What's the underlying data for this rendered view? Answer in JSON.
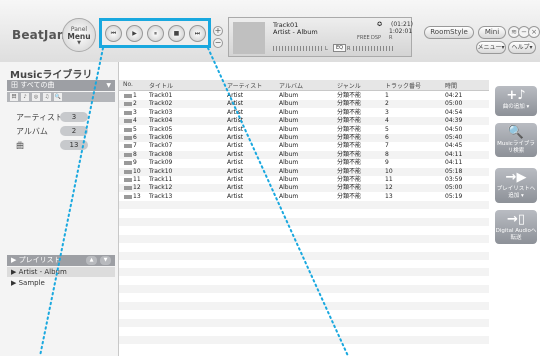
{
  "header": {
    "logo": "BeatJam",
    "panel_menu": {
      "line1": "Panel",
      "line2": "Menu",
      "chevron": "▼"
    },
    "transport": {
      "buttons": [
        {
          "name": "previous",
          "glyph": "⏮"
        },
        {
          "name": "play",
          "glyph": "▶"
        },
        {
          "name": "pause",
          "glyph": "⏸"
        },
        {
          "name": "stop",
          "glyph": "■"
        },
        {
          "name": "next",
          "glyph": "⏭"
        }
      ]
    },
    "volume": {
      "plus": "+",
      "minus": "−"
    },
    "now_playing": {
      "track": "Track01",
      "artist_album": "Artist - Album",
      "record_glyph": "✪",
      "time_total": "(01:21)",
      "time_current": "1:02:01",
      "meter_left": "L",
      "meter_right": "R",
      "mode_button": "EQ",
      "rate_label": "FREE",
      "rate_label2": "DSP",
      "rate_label3": "R"
    },
    "roomstyle_label": "RoomStyle",
    "mini_label": "Mini",
    "menu_label": "メニュー▾",
    "help_label": "ヘルプ▾",
    "window_buttons": [
      "≋",
      "−",
      "×"
    ]
  },
  "sidebar": {
    "title": "Musicライブラリ",
    "all_songs": "田 すべての曲",
    "all_songs_arrow": "▼",
    "filter_icons": [
      "田",
      "♪",
      "◎",
      "♫",
      "🔍"
    ],
    "categories": [
      {
        "label": "アーティスト",
        "count": "3"
      },
      {
        "label": "アルバム",
        "count": "2"
      },
      {
        "label": "曲",
        "count": "13"
      }
    ],
    "playlist_header": "▶ プレイリスト",
    "playlist_arrows": [
      "▲",
      "▼"
    ],
    "playlists": [
      "▶ Artist - Album",
      "▶ Sample"
    ]
  },
  "table": {
    "columns": [
      "No.",
      "タイトル",
      "アーティスト",
      "アルバム",
      "ジャンル",
      "トラック番号",
      "時間"
    ],
    "rows": [
      [
        "1",
        "Track01",
        "Artist",
        "Album",
        "分類不能",
        "1",
        "04:21"
      ],
      [
        "2",
        "Track02",
        "Artist",
        "Album",
        "分類不能",
        "2",
        "05:00"
      ],
      [
        "3",
        "Track03",
        "Artist",
        "Album",
        "分類不能",
        "3",
        "04:54"
      ],
      [
        "4",
        "Track04",
        "Artist",
        "Album",
        "分類不能",
        "4",
        "04:39"
      ],
      [
        "5",
        "Track05",
        "Artist",
        "Album",
        "分類不能",
        "5",
        "04:50"
      ],
      [
        "6",
        "Track06",
        "Artist",
        "Album",
        "分類不能",
        "6",
        "05:40"
      ],
      [
        "7",
        "Track07",
        "Artist",
        "Album",
        "分類不能",
        "7",
        "04:45"
      ],
      [
        "8",
        "Track08",
        "Artist",
        "Album",
        "分類不能",
        "8",
        "04:11"
      ],
      [
        "9",
        "Track09",
        "Artist",
        "Album",
        "分類不能",
        "9",
        "04:11"
      ],
      [
        "10",
        "Track10",
        "Artist",
        "Album",
        "分類不能",
        "10",
        "05:18"
      ],
      [
        "11",
        "Track11",
        "Artist",
        "Album",
        "分類不能",
        "11",
        "03:59"
      ],
      [
        "12",
        "Track12",
        "Artist",
        "Album",
        "分類不能",
        "12",
        "05:00"
      ],
      [
        "13",
        "Track13",
        "Artist",
        "Album",
        "分類不能",
        "13",
        "05:19"
      ]
    ]
  },
  "right_panel": {
    "buttons": [
      {
        "glyph": "+♪",
        "label": "曲の追加 ▾"
      },
      {
        "glyph": "🔍",
        "label": "Musicライブラリ検索"
      },
      {
        "glyph": "→▶",
        "label": "プレイリストへ追加 ▾"
      },
      {
        "glyph": "→▯",
        "label": "Digital Audioへ転送"
      }
    ]
  },
  "colors": {
    "highlight": "#19a8df",
    "header_band": "#9d9fa4",
    "side_button": "#a3a7ad"
  }
}
